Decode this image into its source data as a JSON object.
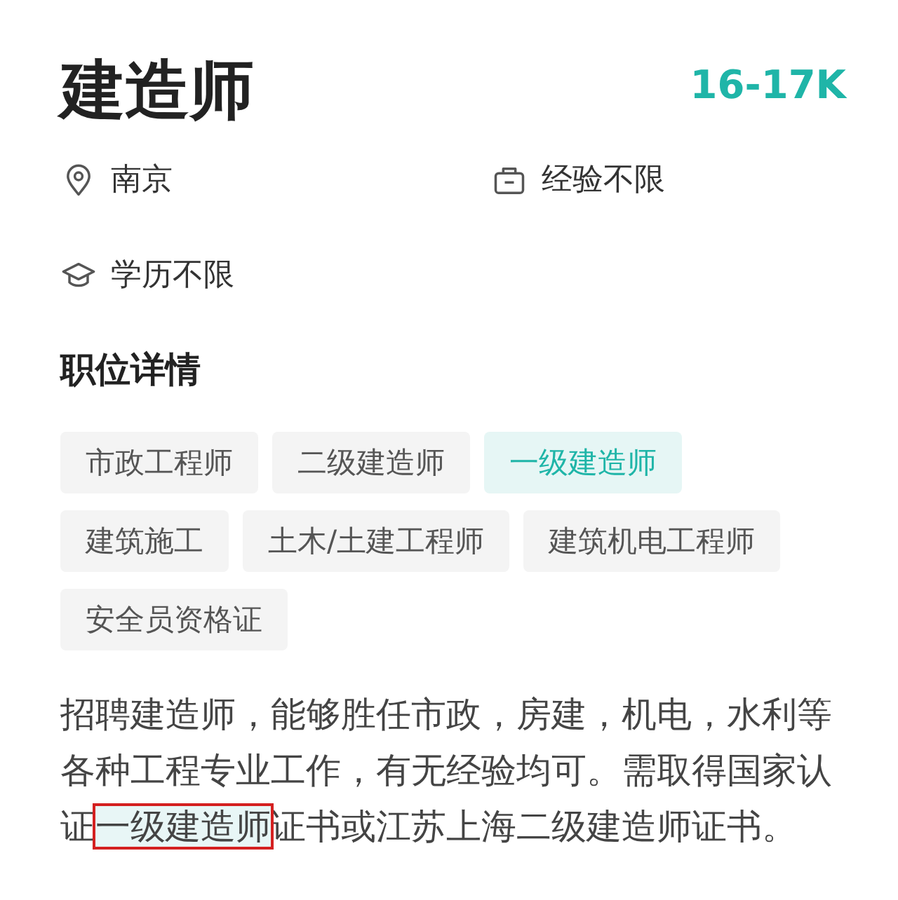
{
  "job": {
    "title": "建造师",
    "salary": "16-17K"
  },
  "meta": [
    {
      "kind": "location",
      "text": "南京"
    },
    {
      "kind": "experience",
      "text": "经验不限"
    },
    {
      "kind": "education",
      "text": "学历不限"
    }
  ],
  "section_title": "职位详情",
  "tags": [
    {
      "label": "市政工程师",
      "selected": false
    },
    {
      "label": "二级建造师",
      "selected": false
    },
    {
      "label": "一级建造师",
      "selected": true
    },
    {
      "label": "建筑施工",
      "selected": false
    },
    {
      "label": "土木/土建工程师",
      "selected": false
    },
    {
      "label": "建筑机电工程师",
      "selected": false
    },
    {
      "label": "安全员资格证",
      "selected": false
    }
  ],
  "description": [
    [
      {
        "text": "招聘建造师，能够胜任市政，房建，机电，水利等",
        "highlighted": false
      }
    ],
    [
      {
        "text": "各种工程专业工作，有无经验均可。需取得国家认",
        "highlighted": false
      }
    ],
    [
      {
        "text": "证",
        "highlighted": false
      },
      {
        "text": "一级建造师",
        "highlighted": true
      },
      {
        "text": "证书或江苏上海二级建造师证书。",
        "highlighted": false
      }
    ]
  ]
}
